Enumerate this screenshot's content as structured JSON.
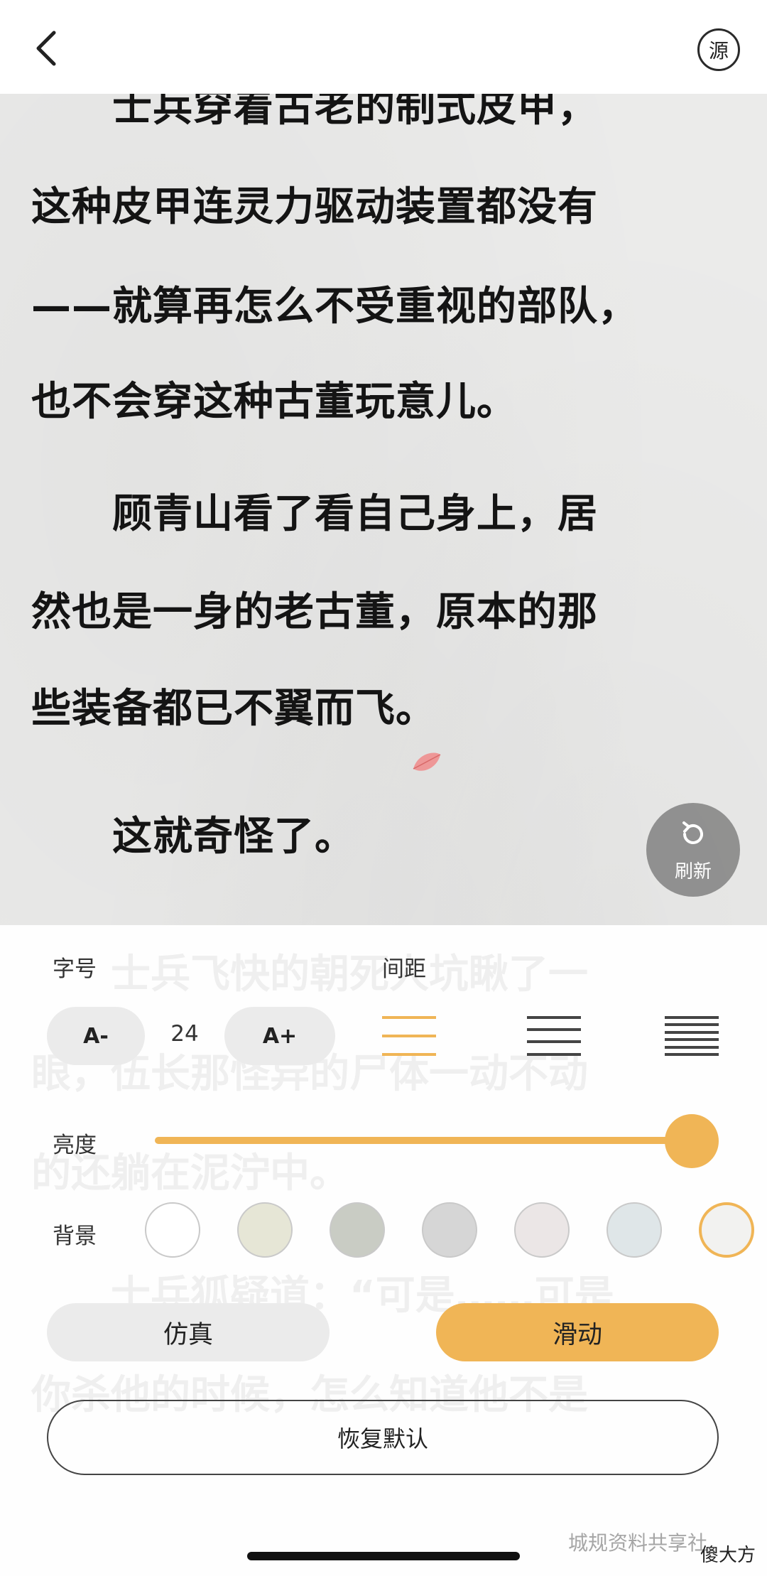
{
  "nav": {
    "back_icon": "chevron-left-icon",
    "source_label": "源"
  },
  "reader": {
    "lines": [
      "　　士兵穿着古老的制式皮甲，",
      "这种皮甲连灵力驱动装置都没有",
      "——就算再怎么不受重视的部队，",
      "也不会穿这种古董玩意儿。",
      "　　顾青山看了看自己身上，居",
      "然也是一身的老古董，原本的那",
      "些装备都已不翼而飞。",
      "　　这就奇怪了。"
    ],
    "ghost_lines": [
      "　　士兵飞快的朝死人坑瞅了一",
      "眼，伍长那怪异的尸体一动不动",
      "的还躺在泥泞中。",
      "　　士兵狐疑道：“可是……可是",
      "你杀他的时候，怎么知道他不是"
    ],
    "refresh_label": "刷新"
  },
  "settings": {
    "font_label": "字号",
    "spacing_label": "间距",
    "font_decrease": "A-",
    "font_size": "24",
    "font_increase": "A+",
    "brightness_label": "亮度",
    "brightness_level": 1.0,
    "background_label": "背景",
    "background_colors": [
      "#ffffff",
      "#e6e6d6",
      "#c9ccc4",
      "#d6d6d6",
      "#ebe6e6",
      "#dfe6e8",
      "#f2f2f0"
    ],
    "selected_background_index": 6,
    "mode_simulate": "仿真",
    "mode_scroll": "滑动",
    "restore_default": "恢复默认"
  },
  "colors": {
    "accent": "#f0b556"
  },
  "watermark": {
    "text": "城规资料共享社",
    "sub": "傻大方"
  }
}
